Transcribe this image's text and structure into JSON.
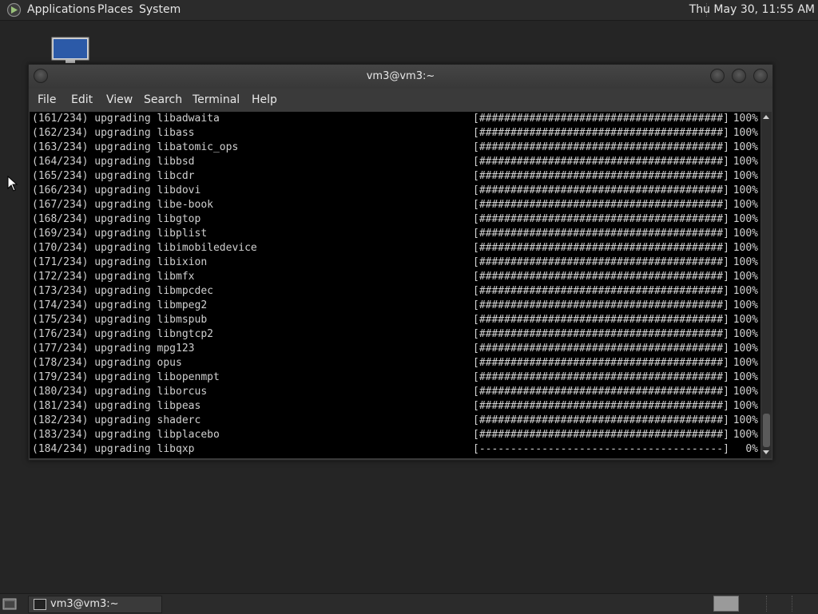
{
  "top_panel": {
    "applications_label": "Applications",
    "places_label": "Places",
    "system_label": "System",
    "clock": "Thu May 30, 11:55 AM"
  },
  "window": {
    "title": "vm3@vm3:~",
    "menu": [
      "File",
      "Edit",
      "View",
      "Search",
      "Terminal",
      "Help"
    ]
  },
  "terminal": {
    "lines": [
      {
        "left": "(161/234) upgrading libadwaita",
        "bar": "[#######################################]",
        "pct": "100%"
      },
      {
        "left": "(162/234) upgrading libass",
        "bar": "[#######################################]",
        "pct": "100%"
      },
      {
        "left": "(163/234) upgrading libatomic_ops",
        "bar": "[#######################################]",
        "pct": "100%"
      },
      {
        "left": "(164/234) upgrading libbsd",
        "bar": "[#######################################]",
        "pct": "100%"
      },
      {
        "left": "(165/234) upgrading libcdr",
        "bar": "[#######################################]",
        "pct": "100%"
      },
      {
        "left": "(166/234) upgrading libdovi",
        "bar": "[#######################################]",
        "pct": "100%"
      },
      {
        "left": "(167/234) upgrading libe-book",
        "bar": "[#######################################]",
        "pct": "100%"
      },
      {
        "left": "(168/234) upgrading libgtop",
        "bar": "[#######################################]",
        "pct": "100%"
      },
      {
        "left": "(169/234) upgrading libplist",
        "bar": "[#######################################]",
        "pct": "100%"
      },
      {
        "left": "(170/234) upgrading libimobiledevice",
        "bar": "[#######################################]",
        "pct": "100%"
      },
      {
        "left": "(171/234) upgrading libixion",
        "bar": "[#######################################]",
        "pct": "100%"
      },
      {
        "left": "(172/234) upgrading libmfx",
        "bar": "[#######################################]",
        "pct": "100%"
      },
      {
        "left": "(173/234) upgrading libmpcdec",
        "bar": "[#######################################]",
        "pct": "100%"
      },
      {
        "left": "(174/234) upgrading libmpeg2",
        "bar": "[#######################################]",
        "pct": "100%"
      },
      {
        "left": "(175/234) upgrading libmspub",
        "bar": "[#######################################]",
        "pct": "100%"
      },
      {
        "left": "(176/234) upgrading libngtcp2",
        "bar": "[#######################################]",
        "pct": "100%"
      },
      {
        "left": "(177/234) upgrading mpg123",
        "bar": "[#######################################]",
        "pct": "100%"
      },
      {
        "left": "(178/234) upgrading opus",
        "bar": "[#######################################]",
        "pct": "100%"
      },
      {
        "left": "(179/234) upgrading libopenmpt",
        "bar": "[#######################################]",
        "pct": "100%"
      },
      {
        "left": "(180/234) upgrading liborcus",
        "bar": "[#######################################]",
        "pct": "100%"
      },
      {
        "left": "(181/234) upgrading libpeas",
        "bar": "[#######################################]",
        "pct": "100%"
      },
      {
        "left": "(182/234) upgrading shaderc",
        "bar": "[#######################################]",
        "pct": "100%"
      },
      {
        "left": "(183/234) upgrading libplacebo",
        "bar": "[#######################################]",
        "pct": "100%"
      },
      {
        "left": "(184/234) upgrading libqxp",
        "bar": "[---------------------------------------]",
        "pct": "0%"
      }
    ]
  },
  "bottom_panel": {
    "task_label": "vm3@vm3:~"
  },
  "colors": {
    "panel": "#2b2b2b",
    "desktop": "#252525",
    "terminal_bg": "#000000",
    "terminal_fg": "#d0d0d0"
  },
  "icons": [
    "app-menu-icon",
    "computer-icon",
    "show-desktop-icon",
    "terminal-icon",
    "mouse-pointer-icon"
  ]
}
